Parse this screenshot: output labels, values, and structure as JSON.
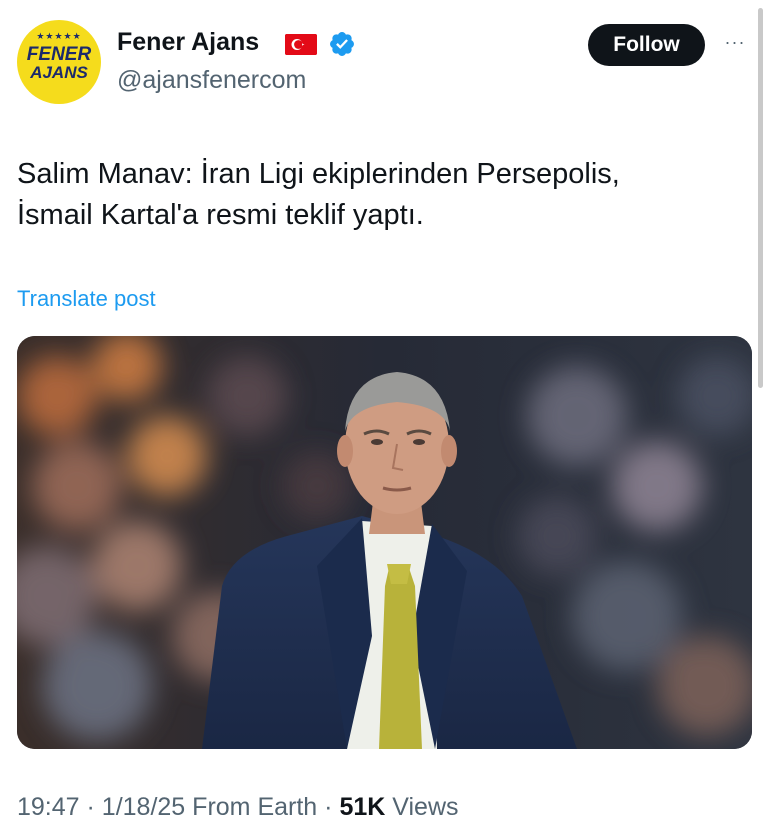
{
  "author": {
    "avatar_text_line1": "FENER",
    "avatar_text_line2": "AJANS",
    "avatar_stars": "★★★★★",
    "display_name": "Fener Ajans",
    "handle": "@ajansfenercom",
    "flag_icon": "turkey-flag-icon",
    "verified_icon": "verified-badge-icon"
  },
  "actions": {
    "follow_label": "Follow",
    "more_icon": "more-options-icon",
    "more_glyph": "···"
  },
  "tweet": {
    "text": "Salim Manav: İran Ligi ekiplerinden Persepolis,\nİsmail Kartal'a resmi teklif yaptı.",
    "translate_label": "Translate post"
  },
  "footer": {
    "time": "19:47",
    "date": "1/18/25",
    "location": "From Earth",
    "separator": "·",
    "views_count": "51K",
    "views_label": "Views"
  },
  "colors": {
    "text_primary": "#0f1419",
    "text_secondary": "#536471",
    "link": "#1d9bf0",
    "verified": "#1d9bf0",
    "avatar_bg": "#f5dc1c",
    "avatar_text": "#1b2a6b",
    "flag_red": "#e30a17"
  }
}
